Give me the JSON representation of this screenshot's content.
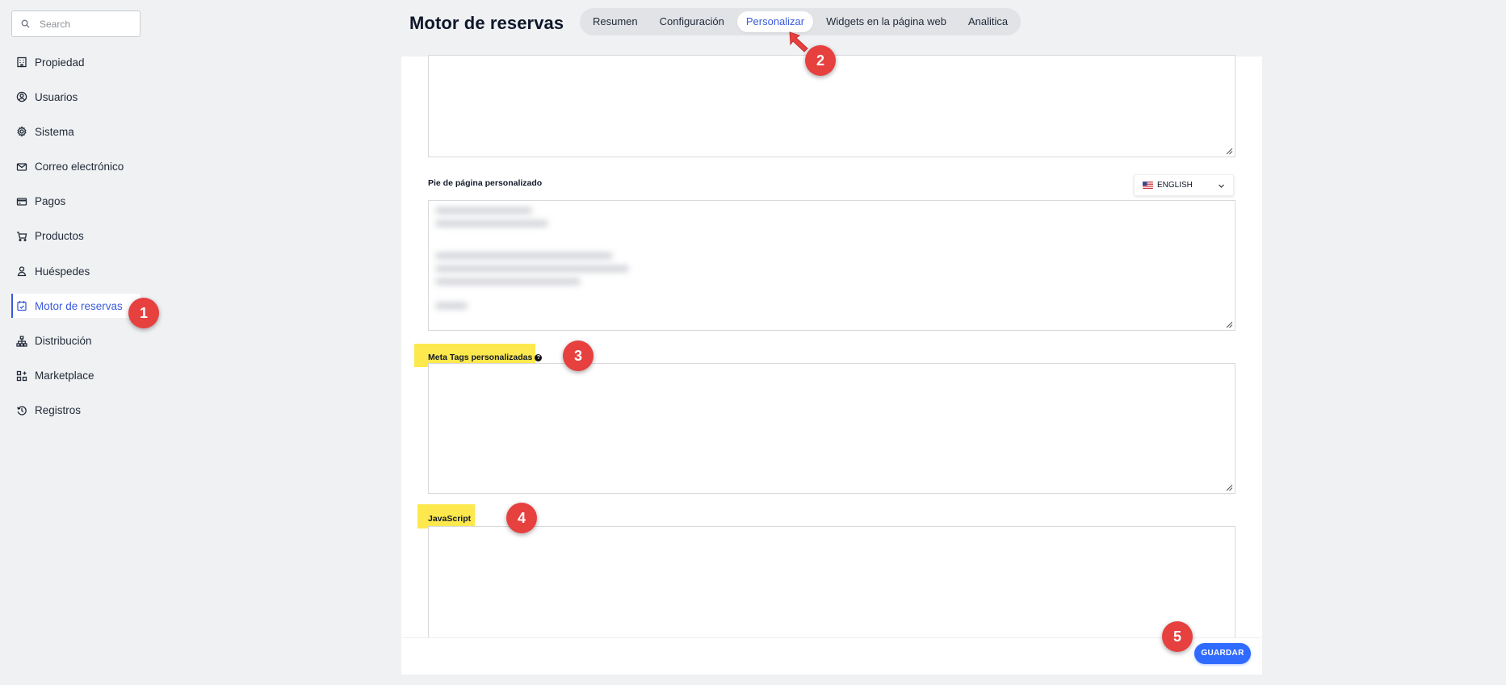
{
  "search": {
    "placeholder": "Search"
  },
  "sidebar": {
    "items": [
      {
        "label": "Propiedad",
        "icon": "building-icon"
      },
      {
        "label": "Usuarios",
        "icon": "user-circle-icon"
      },
      {
        "label": "Sistema",
        "icon": "gear-icon"
      },
      {
        "label": "Correo electrónico",
        "icon": "mail-icon"
      },
      {
        "label": "Pagos",
        "icon": "credit-card-icon"
      },
      {
        "label": "Productos",
        "icon": "cart-icon"
      },
      {
        "label": "Huéspedes",
        "icon": "person-icon"
      },
      {
        "label": "Motor de reservas",
        "icon": "calendar-check-icon",
        "active": true
      },
      {
        "label": "Distribución",
        "icon": "sitemap-icon"
      },
      {
        "label": "Marketplace",
        "icon": "apps-icon"
      },
      {
        "label": "Registros",
        "icon": "history-icon"
      }
    ]
  },
  "header": {
    "title": "Motor de reservas",
    "tabs": [
      {
        "label": "Resumen"
      },
      {
        "label": "Configuración"
      },
      {
        "label": "Personalizar",
        "active": true
      },
      {
        "label": "Widgets en la página web"
      },
      {
        "label": "Analitica"
      }
    ]
  },
  "form": {
    "footer_label": "Pie de página personalizado",
    "language": "ENGLISH",
    "meta_tags_label": "Meta Tags personalizadas",
    "javascript_label": "JavaScript",
    "help_glyph": "?"
  },
  "actions": {
    "save_label": "GUARDAR"
  },
  "callouts": [
    "1",
    "2",
    "3",
    "4",
    "5"
  ],
  "colors": {
    "accent": "#3b5bdb",
    "save": "#2f6bff",
    "callout": "#e6403f",
    "highlight": "#fde94d"
  }
}
